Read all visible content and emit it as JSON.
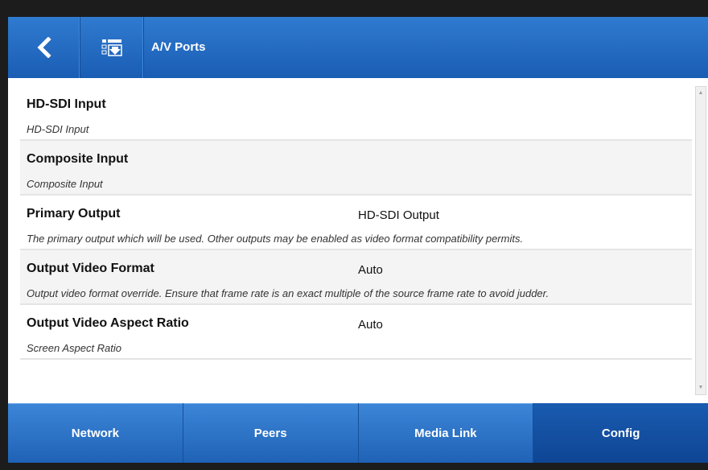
{
  "header": {
    "back_icon": "chevron-left-icon",
    "menu_icon": "download-list-icon",
    "title": "A/V Ports"
  },
  "settings": [
    {
      "title": "HD-SDI Input",
      "value": "",
      "description": "HD-SDI Input"
    },
    {
      "title": "Composite Input",
      "value": "",
      "description": "Composite Input"
    },
    {
      "title": "Primary Output",
      "value": "HD-SDI Output",
      "description": "The primary output which will be used. Other outputs may be enabled as video format compatibility permits."
    },
    {
      "title": "Output Video Format",
      "value": "Auto",
      "description": "Output video format override. Ensure that frame rate is an exact multiple of the source frame rate to avoid judder."
    },
    {
      "title": "Output Video Aspect Ratio",
      "value": "Auto",
      "description": "Screen Aspect Ratio"
    }
  ],
  "tabs": [
    {
      "label": "Network",
      "active": false
    },
    {
      "label": "Peers",
      "active": false
    },
    {
      "label": "Media Link",
      "active": false
    },
    {
      "label": "Config",
      "active": true
    }
  ],
  "colors": {
    "header_blue": "#2f7bd0",
    "tab_blue": "#2a6fc4",
    "tab_active": "#134d9e"
  }
}
